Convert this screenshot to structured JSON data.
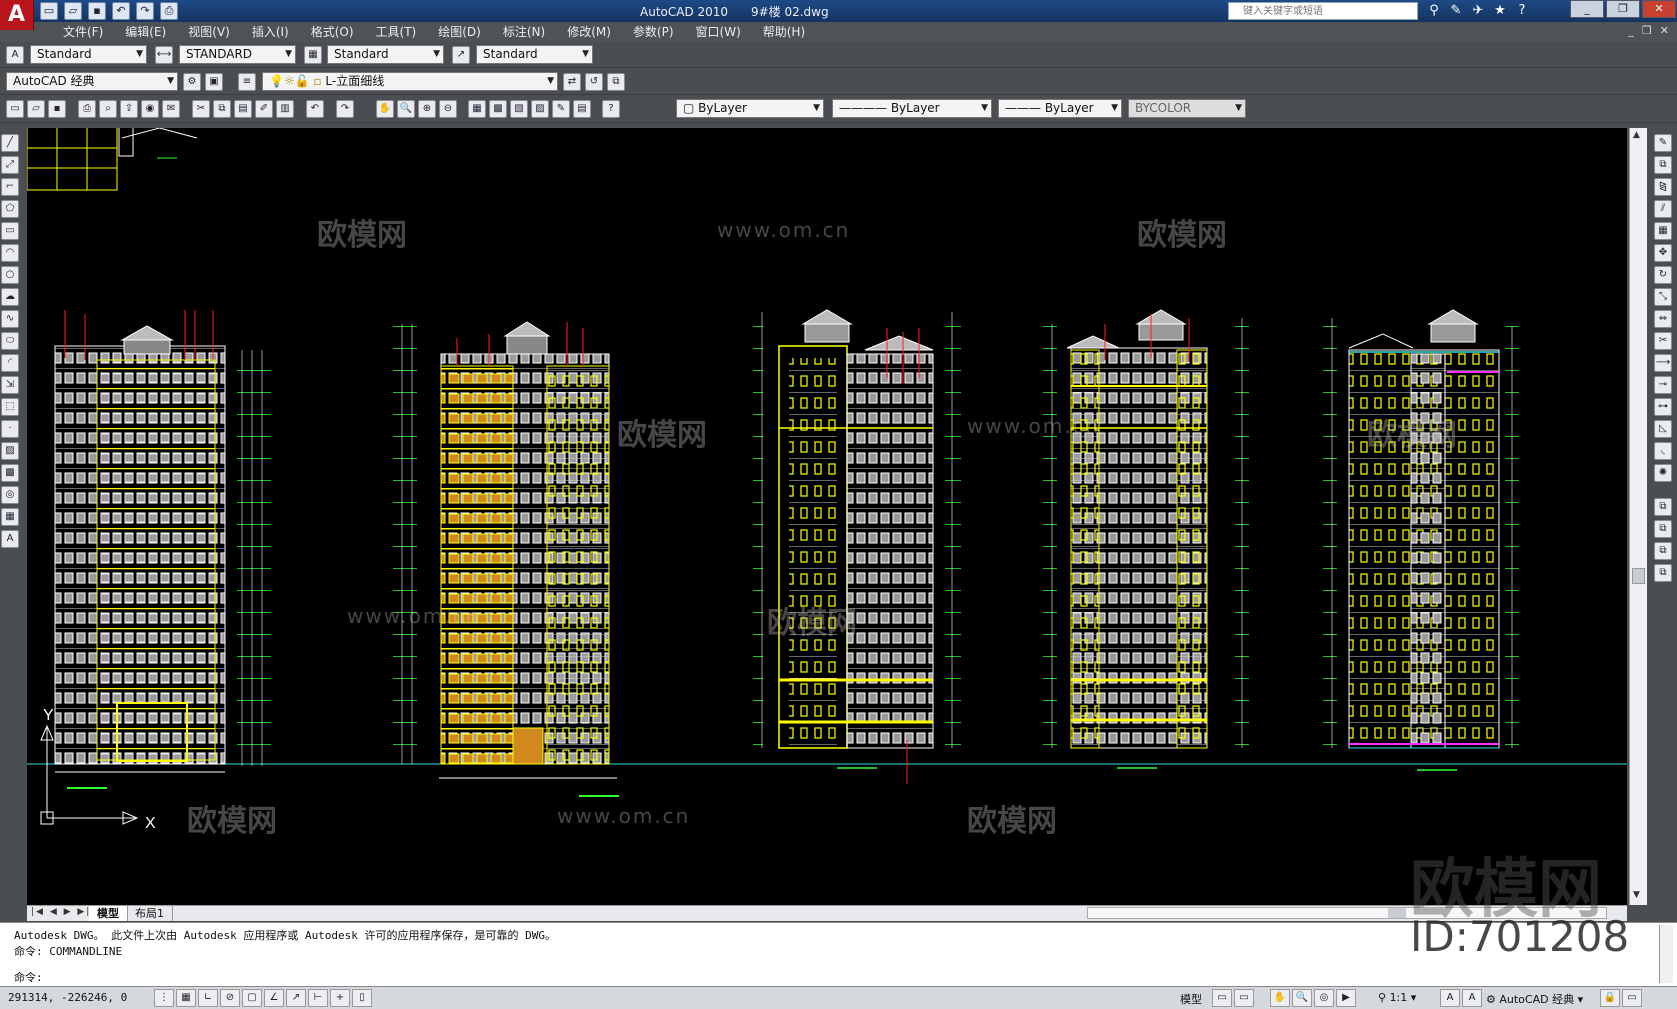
{
  "app": {
    "logo": "A",
    "title": "AutoCAD 2010",
    "file": "9#楼 02.dwg",
    "search_placeholder": "键入关键字或短语"
  },
  "menu": [
    "文件(F)",
    "编辑(E)",
    "视图(V)",
    "插入(I)",
    "格式(O)",
    "工具(T)",
    "绘图(D)",
    "标注(N)",
    "修改(M)",
    "参数(P)",
    "窗口(W)",
    "帮助(H)"
  ],
  "styles_toolbar": {
    "text_style": "Standard",
    "dim_style": "STANDARD",
    "table_style": "Standard",
    "multileader_style": "Standard"
  },
  "workspace_toolbar": {
    "workspace": "AutoCAD 经典",
    "layer": "L-立面细线"
  },
  "properties_toolbar": {
    "color": "ByLayer",
    "linetype": "ByLayer",
    "lineweight": "ByLayer",
    "plotstyle": "BYCOLOR"
  },
  "tabs": [
    "模型",
    "布局1"
  ],
  "command": {
    "line1": "Autodesk DWG。  此文件上次由 Autodesk 应用程序或 Autodesk 许可的应用程序保存，是可靠的 DWG。",
    "line2": "命令: COMMANDLINE",
    "prompt": "命令:"
  },
  "status": {
    "coords": "291314, -226246, 0",
    "model_label": "模型",
    "scale": "1:1",
    "workspace": "AutoCAD 经典"
  },
  "ucs": {
    "y": "Y",
    "x": "X"
  },
  "watermark": {
    "brand": "欧模网",
    "url": "www.om.cn",
    "id": "ID:701208"
  },
  "colors": {
    "title_bar": "#1e4a86",
    "canvas": "#000000",
    "line_yellow": "#ffff00",
    "line_white": "#ffffff",
    "line_red": "#ff2020",
    "line_green": "#30ff30",
    "line_cyan": "#30e0e0",
    "line_magenta": "#ff30ff"
  }
}
